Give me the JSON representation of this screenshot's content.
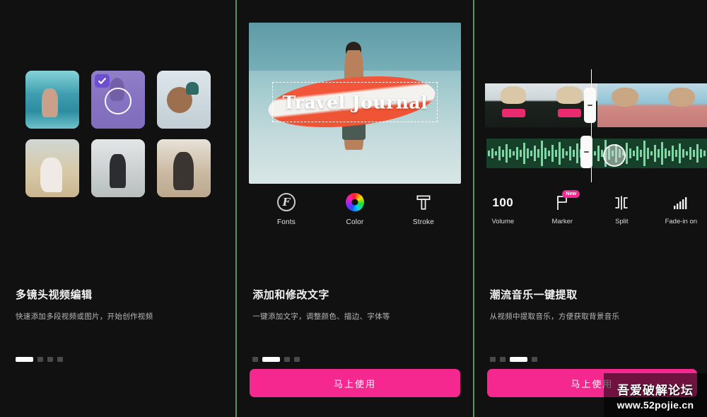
{
  "app": {
    "background": "#111111",
    "accent_pink": "#f5288f",
    "separator_color": "#5f8f63",
    "selection_purple": "#6c4fd0",
    "waveform_green": "#7fd6a4"
  },
  "panels": [
    {
      "id": "multi-clip-edit",
      "title": "多镜头视频编辑",
      "subtitle": "快速添加多段视频或图片，开始创作视频",
      "active_dot": 0,
      "dots": 4,
      "has_cta": false,
      "media_grid": {
        "items": [
          {
            "name": "beach-woman-thumb",
            "selected": false
          },
          {
            "name": "purple-selected-thumb",
            "selected": true
          },
          {
            "name": "guitar-person-thumb",
            "selected": false
          },
          {
            "name": "desert-dress-thumb",
            "selected": false
          },
          {
            "name": "backpacker-thumb",
            "selected": false
          },
          {
            "name": "field-woman-thumb",
            "selected": false
          }
        ]
      }
    },
    {
      "id": "add-edit-text",
      "title": "添加和修改文字",
      "subtitle": "一键添加文字，调整颜色、描边、字体等",
      "active_dot": 1,
      "dots": 4,
      "has_cta": true,
      "cta_label": "马上使用",
      "preview": {
        "overlay_text": "Travel Journal",
        "image_name": "surfer-beach-photo"
      },
      "tools": [
        {
          "icon": "fonts-icon",
          "label": "Fonts",
          "glyph": "F"
        },
        {
          "icon": "color-wheel-icon",
          "label": "Color"
        },
        {
          "icon": "stroke-t-icon",
          "label": "Stroke"
        }
      ]
    },
    {
      "id": "extract-music",
      "title": "潮流音乐一键提取",
      "subtitle": "从视频中提取音乐，方便获取背景音乐",
      "active_dot": 2,
      "dots": 4,
      "has_cta": true,
      "cta_label": "马上使用",
      "timeline": {
        "video_track_name": "video-filmstrip",
        "audio_track_name": "audio-waveform"
      },
      "tools": [
        {
          "icon": "volume-icon",
          "label": "Volume",
          "value": "100"
        },
        {
          "icon": "marker-flag-icon",
          "label": "Marker",
          "badge": "New"
        },
        {
          "icon": "split-icon",
          "label": "Split"
        },
        {
          "icon": "fade-in-icon",
          "label": "Fade-in on"
        }
      ]
    }
  ],
  "watermark": {
    "line1": "吾爱破解论坛",
    "line2": "www.52pojie.cn"
  }
}
